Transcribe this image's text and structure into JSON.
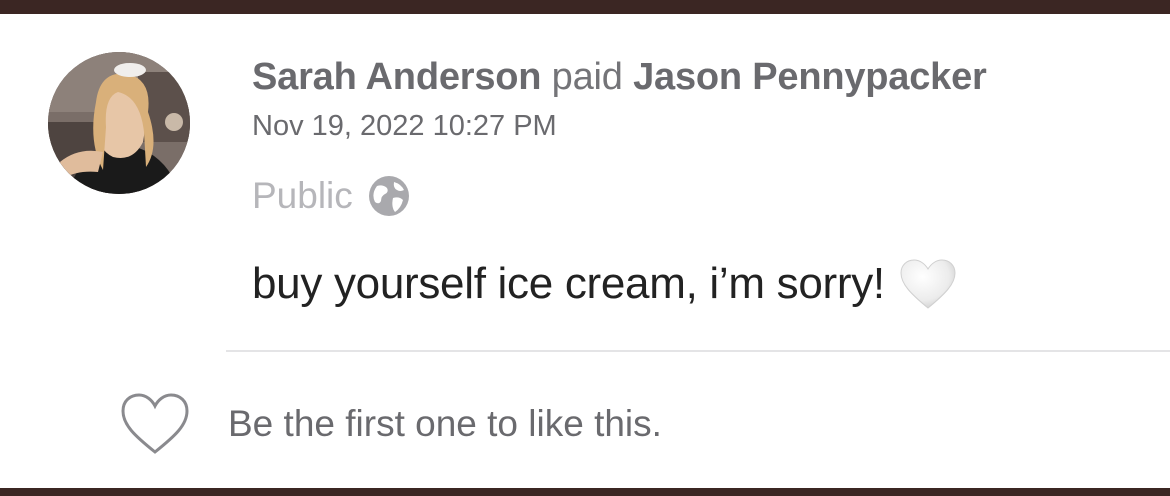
{
  "payment": {
    "sender": "Sarah Anderson",
    "verb": "paid",
    "recipient": "Jason Pennypacker",
    "timestamp": "Nov 19, 2022 10:27 PM",
    "privacy": "Public",
    "privacy_icon": "globe-icon",
    "note": "buy yourself ice cream, i’m sorry!",
    "note_emoji": "white-heart-emoji"
  },
  "likes": {
    "icon": "heart-outline-icon",
    "text": "Be the first one to like this."
  },
  "colors": {
    "frame": "#3b2623",
    "card": "#ffffff",
    "muted_text": "#6a6a6e",
    "light_text": "#b6b6ba",
    "body_text": "#222222",
    "divider": "#e4e4e6"
  }
}
